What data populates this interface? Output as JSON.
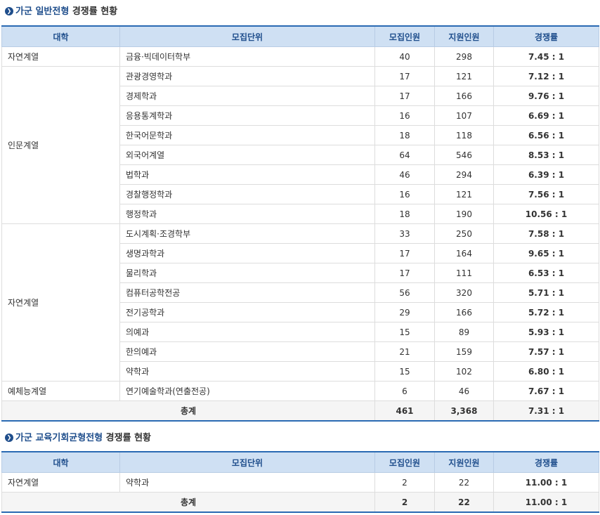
{
  "section1": {
    "title_prefix": "가군",
    "title_type": "일반전형",
    "title_suffix": "경쟁률 현황"
  },
  "section2": {
    "title_prefix": "가군",
    "title_type": "교육기회균형전형",
    "title_suffix": "경쟁률 현황"
  },
  "headers": {
    "college": "대학",
    "unit": "모집단위",
    "quota": "모집인원",
    "applicants": "지원인원",
    "ratio": "경쟁률"
  },
  "table1": {
    "groups": [
      {
        "college": "자연계열",
        "rows": [
          {
            "unit": "금융·빅데이터학부",
            "quota": "40",
            "applicants": "298",
            "ratio": "7.45 : 1"
          }
        ]
      },
      {
        "college": "인문계열",
        "rows": [
          {
            "unit": "관광경영학과",
            "quota": "17",
            "applicants": "121",
            "ratio": "7.12 : 1"
          },
          {
            "unit": "경제학과",
            "quota": "17",
            "applicants": "166",
            "ratio": "9.76 : 1"
          },
          {
            "unit": "응용통계학과",
            "quota": "16",
            "applicants": "107",
            "ratio": "6.69 : 1"
          },
          {
            "unit": "한국어문학과",
            "quota": "18",
            "applicants": "118",
            "ratio": "6.56 : 1"
          },
          {
            "unit": "외국어계열",
            "quota": "64",
            "applicants": "546",
            "ratio": "8.53 : 1"
          },
          {
            "unit": "법학과",
            "quota": "46",
            "applicants": "294",
            "ratio": "6.39 : 1"
          },
          {
            "unit": "경찰행정학과",
            "quota": "16",
            "applicants": "121",
            "ratio": "7.56 : 1"
          },
          {
            "unit": "행정학과",
            "quota": "18",
            "applicants": "190",
            "ratio": "10.56 : 1"
          }
        ]
      },
      {
        "college": "자연계열",
        "rows": [
          {
            "unit": "도시계획·조경학부",
            "quota": "33",
            "applicants": "250",
            "ratio": "7.58 : 1"
          },
          {
            "unit": "생명과학과",
            "quota": "17",
            "applicants": "164",
            "ratio": "9.65 : 1"
          },
          {
            "unit": "물리학과",
            "quota": "17",
            "applicants": "111",
            "ratio": "6.53 : 1"
          },
          {
            "unit": "컴퓨터공학전공",
            "quota": "56",
            "applicants": "320",
            "ratio": "5.71 : 1"
          },
          {
            "unit": "전기공학과",
            "quota": "29",
            "applicants": "166",
            "ratio": "5.72 : 1"
          },
          {
            "unit": "의예과",
            "quota": "15",
            "applicants": "89",
            "ratio": "5.93 : 1"
          },
          {
            "unit": "한의예과",
            "quota": "21",
            "applicants": "159",
            "ratio": "7.57 : 1"
          },
          {
            "unit": "약학과",
            "quota": "15",
            "applicants": "102",
            "ratio": "6.80 : 1"
          }
        ]
      },
      {
        "college": "예체능계열",
        "rows": [
          {
            "unit": "연기예술학과(연출전공)",
            "quota": "6",
            "applicants": "46",
            "ratio": "7.67 : 1"
          }
        ]
      }
    ],
    "total": {
      "label": "총계",
      "quota": "461",
      "applicants": "3,368",
      "ratio": "7.31 : 1"
    }
  },
  "table2": {
    "groups": [
      {
        "college": "자연계열",
        "rows": [
          {
            "unit": "약학과",
            "quota": "2",
            "applicants": "22",
            "ratio": "11.00 : 1"
          }
        ]
      }
    ],
    "total": {
      "label": "총계",
      "quota": "2",
      "applicants": "22",
      "ratio": "11.00 : 1"
    }
  },
  "colors": {
    "accent": "#1f4e8c",
    "header_bg": "#cfe0f3",
    "header_border": "#2a6ab3",
    "total_bg": "#f5f5f5"
  }
}
